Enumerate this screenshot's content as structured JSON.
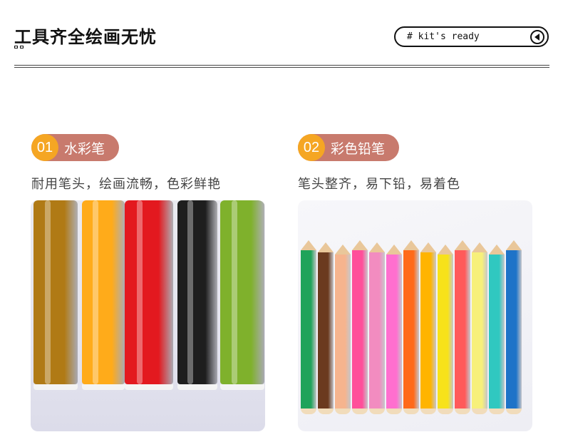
{
  "header": {
    "title": "工具齐全绘画无忧",
    "kit_label": "# kit's ready"
  },
  "sections": [
    {
      "number": "01",
      "title": "水彩笔",
      "description": "耐用笔头，绘画流畅，色彩鲜艳",
      "pen_colors": [
        "#b07a15",
        "#ffab1a",
        "#e3191f",
        "#1e1e1e",
        "#7fb12c"
      ]
    },
    {
      "number": "02",
      "title": "彩色铅笔",
      "description": "笔头整齐，易下铅，易着色",
      "pencil_colors": [
        "#1fa35a",
        "#6b3a1f",
        "#f6b48e",
        "#ff4f9a",
        "#f28cc0",
        "#ff6fcf",
        "#ff6a1a",
        "#ffb400",
        "#f7e21a",
        "#ff5a5a",
        "#f7f07a",
        "#30c8c0",
        "#1e73c8"
      ]
    }
  ]
}
